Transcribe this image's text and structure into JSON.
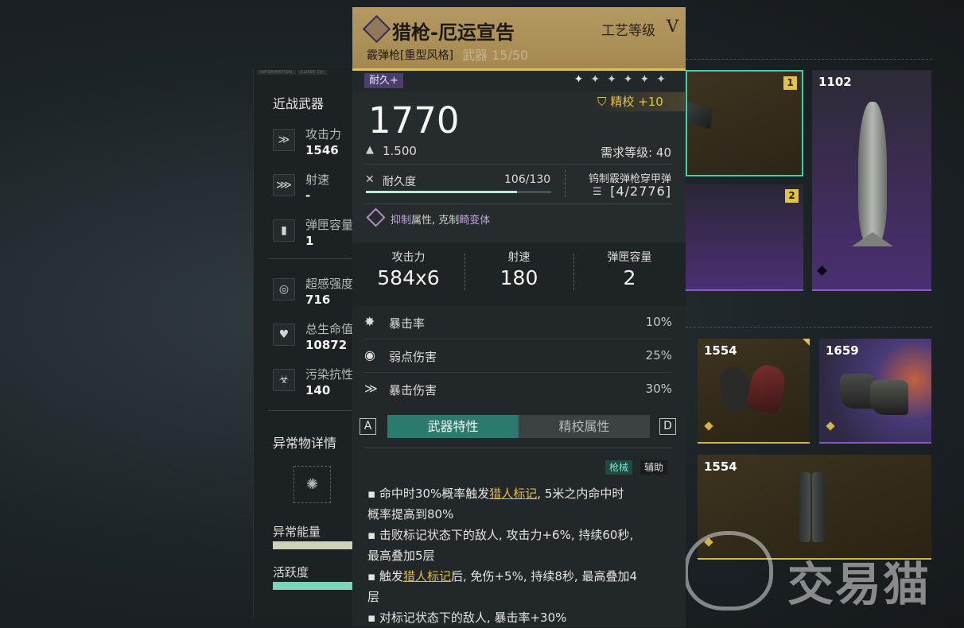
{
  "stats_panel": {
    "tabs": [
      "INFORMATION",
      "CLOSE (1)"
    ],
    "melee_title": "近战武器",
    "rows1": [
      {
        "icon": "claw-attack-icon",
        "glyph": "≫",
        "label": "攻击力",
        "value": "1546"
      },
      {
        "icon": "fire-rate-icon",
        "glyph": "⋙",
        "label": "射速",
        "value": "-"
      },
      {
        "icon": "magazine-icon",
        "glyph": "▮",
        "label": "弹匣容量",
        "value": "1"
      }
    ],
    "rows2": [
      {
        "icon": "spiral-sense-icon",
        "glyph": "◎",
        "label": "超感强度",
        "value": "716"
      },
      {
        "icon": "heart-health-icon",
        "glyph": "♥",
        "label": "总生命值",
        "value": "10872"
      },
      {
        "icon": "biohazard-icon",
        "glyph": "☣",
        "label": "污染抗性",
        "value": "140"
      }
    ],
    "anomaly_title": "异常物详情",
    "anomaly_energy_label": "异常能量",
    "activity_label": "活跃度"
  },
  "card": {
    "name": "猎枪-厄运宣告",
    "craft_label": "工艺等级",
    "craft_level": "V",
    "subtitle": "霰弹枪[重型风格]",
    "faded_text": "武器 15/50",
    "tag": "耐久+",
    "stars": [
      "✦",
      "✦",
      "✦",
      "✦",
      "✦",
      "✦"
    ],
    "refine_label": "精校 +10",
    "power": "1770",
    "weight": "1.500",
    "req_level": "需求等级: 40",
    "durability_label": "耐久度",
    "durability_value": "106/130",
    "durability_fraction": 0.815,
    "ammo_name": "钨制霰弹枪穿甲弹",
    "ammo_count": "[4/2776]",
    "trait_a": "抑制",
    "trait_b": "属性, 克制",
    "trait_c": "畸变体",
    "big_stats": [
      {
        "label": "攻击力",
        "value": "584x6"
      },
      {
        "label": "射速",
        "value": "180"
      },
      {
        "label": "弹匣容量",
        "value": "2"
      }
    ],
    "props": [
      {
        "icon": "burst-crit-icon",
        "glyph": "✸",
        "label": "暴击率",
        "value": "10%"
      },
      {
        "icon": "weakspot-target-icon",
        "glyph": "◉",
        "label": "弱点伤害",
        "value": "25%"
      },
      {
        "icon": "crit-damage-icon",
        "glyph": "≫",
        "label": "暴击伤害",
        "value": "30%"
      }
    ],
    "key_left": "A",
    "key_right": "D",
    "tab_active": "武器特性",
    "tab_inactive": "精校属性",
    "chip1": "枪械",
    "chip2": "辅助",
    "desc": [
      {
        "pre": "▪ 命中时30%概率触发",
        "link": "猎人标记",
        "post": ", 5米之内命中时"
      },
      {
        "pre": "概率提高到80%",
        "link": "",
        "post": ""
      },
      {
        "pre": "▪ 击败标记状态下的敌人, 攻击力+6%, 持续60秒,",
        "link": "",
        "post": ""
      },
      {
        "pre": "最高叠加5层",
        "link": "",
        "post": ""
      },
      {
        "pre": "▪ 触发",
        "link": "猎人标记",
        "post": "后, 免伤+5%, 持续8秒, 最高叠加4"
      },
      {
        "pre": "层",
        "link": "",
        "post": ""
      },
      {
        "pre": "▪ 对标记状态下的敌人, 暴击率+30%",
        "link": "",
        "post": ""
      }
    ]
  },
  "grid": {
    "slots": [
      {
        "num": "",
        "badge": "1"
      },
      {
        "num": "1102",
        "badge": ""
      },
      {
        "num": "",
        "badge": "2"
      },
      {
        "num": "1554",
        "badge": ""
      },
      {
        "num": "1659",
        "badge": ""
      },
      {
        "num": "1554",
        "badge": ""
      }
    ]
  },
  "watermark": "交易猫",
  "colors": {
    "gold": "#e4c24a",
    "teal": "#2a7a6e",
    "purple": "#6a3f9a",
    "card_head": "#b49a62"
  }
}
